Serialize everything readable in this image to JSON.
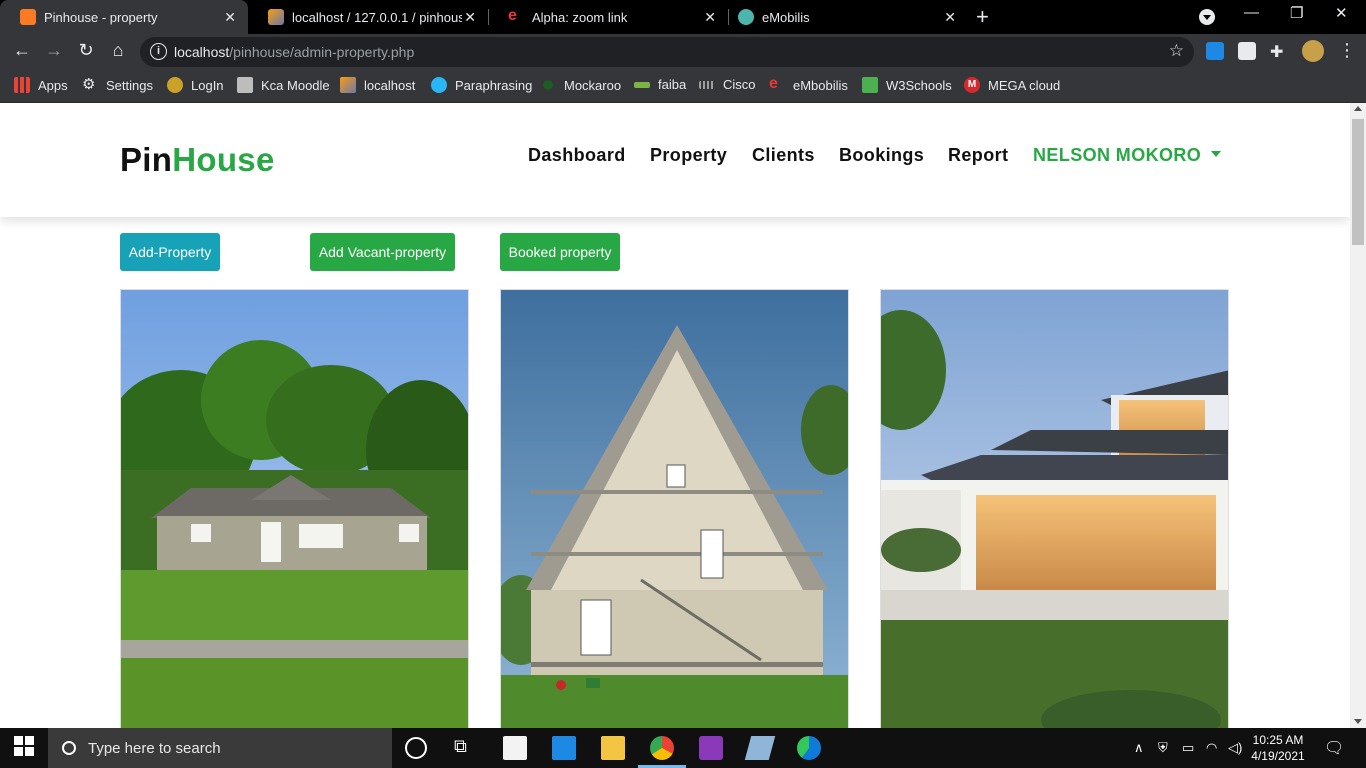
{
  "browser": {
    "tabs": [
      {
        "title": "Pinhouse - property",
        "active": true,
        "icon": "xampp-icon"
      },
      {
        "title": "localhost / 127.0.0.1 / pinhouse / ",
        "active": false,
        "icon": "phpmyadmin-icon"
      },
      {
        "title": "Alpha: zoom link",
        "active": false,
        "icon": "emobilis-e-icon"
      },
      {
        "title": "eMobilis",
        "active": false,
        "icon": "globe-icon"
      }
    ],
    "address": {
      "host": "localhost",
      "path": "/pinhouse/admin-property.php"
    },
    "bookmarks": [
      {
        "label": "Apps",
        "icon": "apps-grid-icon"
      },
      {
        "label": "Settings",
        "icon": "gear-icon"
      },
      {
        "label": "LogIn",
        "icon": "login-icon"
      },
      {
        "label": "Kca Moodle",
        "icon": "moodle-icon"
      },
      {
        "label": "localhost",
        "icon": "phpmyadmin-icon"
      },
      {
        "label": "Paraphrasing",
        "icon": "paraphrasing-icon"
      },
      {
        "label": "Mockaroo",
        "icon": "mockaroo-icon"
      },
      {
        "label": "faiba",
        "icon": "faiba-icon"
      },
      {
        "label": "Cisco",
        "icon": "cisco-icon"
      },
      {
        "label": "eMbobilis",
        "icon": "emobilis-e-icon"
      },
      {
        "label": "W3Schools",
        "icon": "w3schools-icon"
      },
      {
        "label": "MEGA cloud",
        "icon": "mega-icon"
      }
    ]
  },
  "site": {
    "brand_first": "Pin",
    "brand_second": "House",
    "nav": [
      "Dashboard",
      "Property",
      "Clients",
      "Bookings",
      "Report"
    ],
    "user": "NELSON MOKORO",
    "buttons": {
      "add_property": "Add-Property",
      "add_vacant": "Add Vacant-property",
      "booked": "Booked property"
    },
    "colors": {
      "accent": "#28a745",
      "info": "#17a2b8"
    },
    "cards": [
      {
        "image": "single-storey-house-photo"
      },
      {
        "image": "a-frame-house-photo"
      },
      {
        "image": "modern-house-dusk-photo"
      }
    ]
  },
  "taskbar": {
    "search_placeholder": "Type here to search",
    "time": "10:25 AM",
    "date": "4/19/2021"
  }
}
